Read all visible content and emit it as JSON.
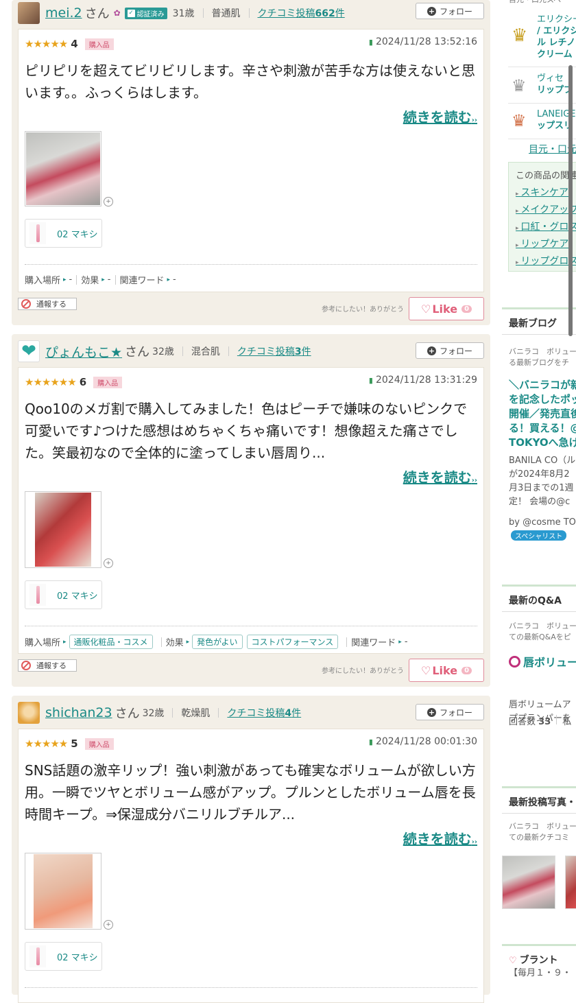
{
  "reviews": [
    {
      "user": "mei.2",
      "san": "さん",
      "verified": "認証済み",
      "age": "31歳",
      "skin": "普通肌",
      "posts_prefix": "クチコミ投稿",
      "posts_count": "662",
      "posts_suffix": "件",
      "follow": "フォロー",
      "rating": "4",
      "purchased": "購入品",
      "date": "2024/11/28 13:52:16",
      "text": "ピリピリを超えてビリビリします。辛さや刺激が苦手な方は使えないと思います。。ふっくらはします。",
      "read_more": "続きを読む",
      "color": "02 マキシ",
      "place_label": "購入場所",
      "place": "-",
      "effect_label": "効果",
      "effect": "-",
      "words_label": "関連ワード",
      "words": "-",
      "report": "通報する",
      "thanks": "参考にしたい！ありがとう",
      "like": "Like",
      "like_count": "0"
    },
    {
      "user": "ぴょんもこ★",
      "san": "さん",
      "age": "32歳",
      "skin": "混合肌",
      "posts_prefix": "クチコミ投稿",
      "posts_count": "3",
      "posts_suffix": "件",
      "follow": "フォロー",
      "rating": "6",
      "purchased": "購入品",
      "date": "2024/11/28 13:31:29",
      "text": "Qoo10のメガ割で購入してみました！色はピーチで嫌味のないピンクで可愛いです♪つけた感想はめちゃくちゃ痛いです！想像超えた痛さでした。笑最初なので全体的に塗ってしまい唇周り...",
      "read_more": "続きを読む",
      "color": "02 マキシ",
      "place_label": "購入場所",
      "place": "通販化粧品・コスメ",
      "effect_label": "効果",
      "effect1": "発色がよい",
      "effect2": "コストパフォーマンス",
      "words_label": "関連ワード",
      "words": "-",
      "report": "通報する",
      "thanks": "参考にしたい！ありがとう",
      "like": "Like",
      "like_count": "0"
    },
    {
      "user": "shichan23",
      "san": "さん",
      "age": "32歳",
      "skin": "乾燥肌",
      "posts_prefix": "クチコミ投稿",
      "posts_count": "4",
      "posts_suffix": "件",
      "follow": "フォロー",
      "rating": "5",
      "purchased": "購入品",
      "date": "2024/11/28 00:01:30",
      "text": "SNS話題の激辛リップ！強い刺激があっても確実なボリュームが欲しい方用。一瞬でツヤとボリューム感がアップ。プルンとしたボリューム唇を長時間キープ。⇒保湿成分バニリルブチルア...",
      "read_more": "続きを読む",
      "color": "02 マキシ"
    }
  ],
  "sidebar": {
    "top_crumb": "目元・口元スペ",
    "rank1_brand": "エリクシール",
    "rank1_name": "/ エリクシール レチノパワー リンクルクリーム",
    "rank1_l1": "/ エリクシ",
    "rank1_l2": "ル レチノ",
    "rank1_l3": "クリーム",
    "rank2_brand": "ヴィセ",
    "rank2_name": "リップブ",
    "rank3_brand": "LANEIGE",
    "rank3_name": "ップスリ",
    "crumb_link": "目元・口元",
    "related_title": "この商品の関連",
    "related": [
      "スキンケア",
      "メイクアップ",
      "口紅・グロス",
      "リップケア",
      "リップグロス"
    ],
    "blog_title": "最新ブログ",
    "blog_desc1": "バニラコ　ボリュー",
    "blog_desc2": "る最新ブログをチ",
    "blog_head": [
      "＼バニラコが新",
      "を記念したポッ",
      "開催／発売直後",
      "る！買える！@",
      "TOKYOへ急げ"
    ],
    "blog_body": [
      "BANILA CO（ル",
      "が2024年8月2",
      "月3日までの1週",
      "定！ 会場の@c"
    ],
    "blog_by": "by @cosme TO",
    "specialist": "スペシャリスト",
    "qa_title": "最新のQ&A",
    "qa_desc1": "バニラコ　ボリュー",
    "qa_desc2": "ての最新Q&Aをピ",
    "qa_head": "唇ボリュー",
    "qa_body1": "唇ボリュームア",
    "qa_body2": "ププランパーを",
    "qa_answers_label": "回答数",
    "qa_answers": "33",
    "qa_extra": "私",
    "photo_title": "最新投稿写真・",
    "photo_desc1": "バニラコ　ボリュー",
    "photo_desc2": "ての最新クチコミ",
    "bfc_title": "ブラント",
    "bfc_sub": "【毎月１・９・"
  }
}
